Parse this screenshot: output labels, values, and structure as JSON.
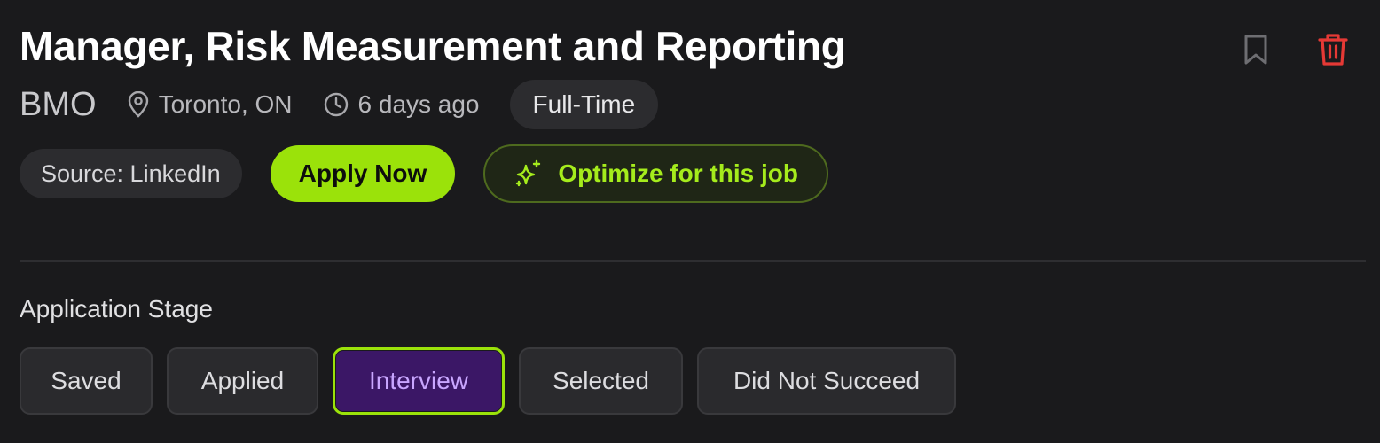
{
  "job": {
    "title": "Manager, Risk Measurement and Reporting",
    "company": "BMO",
    "location": "Toronto, ON",
    "posted": "6 days ago",
    "employment_type": "Full-Time",
    "source": "Source: LinkedIn"
  },
  "actions": {
    "apply_label": "Apply Now",
    "optimize_label": "Optimize for this job"
  },
  "icons": {
    "bookmark": "bookmark-icon",
    "delete": "trash-icon",
    "location": "map-pin-icon",
    "time": "clock-icon",
    "optimize": "sparkles-icon"
  },
  "stage": {
    "label": "Application Stage",
    "options": [
      "Saved",
      "Applied",
      "Interview",
      "Selected",
      "Did Not Succeed"
    ],
    "selected": "Interview"
  },
  "colors": {
    "accent": "#9be20a",
    "danger": "#e53935",
    "selected_stage_bg": "#3b1766",
    "selected_stage_text": "#c9a6ff"
  }
}
